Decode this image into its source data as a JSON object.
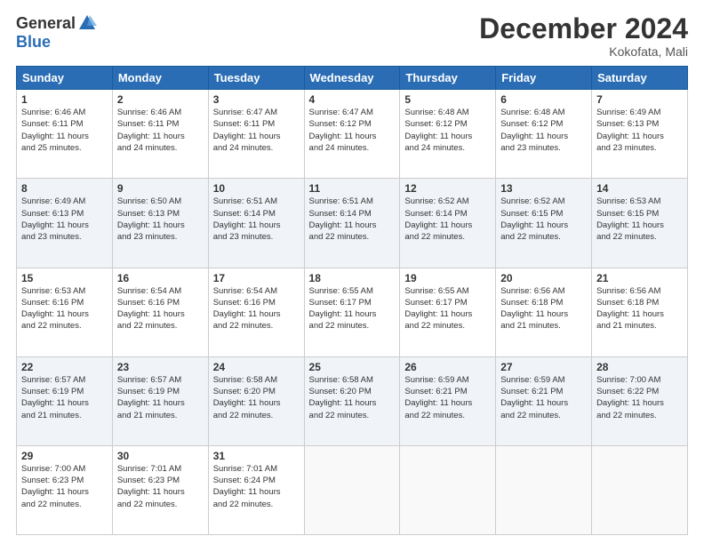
{
  "logo": {
    "general": "General",
    "blue": "Blue"
  },
  "title": "December 2024",
  "location": "Kokofata, Mali",
  "days_header": [
    "Sunday",
    "Monday",
    "Tuesday",
    "Wednesday",
    "Thursday",
    "Friday",
    "Saturday"
  ],
  "weeks": [
    [
      {
        "day": "1",
        "info": "Sunrise: 6:46 AM\nSunset: 6:11 PM\nDaylight: 11 hours\nand 25 minutes."
      },
      {
        "day": "2",
        "info": "Sunrise: 6:46 AM\nSunset: 6:11 PM\nDaylight: 11 hours\nand 24 minutes."
      },
      {
        "day": "3",
        "info": "Sunrise: 6:47 AM\nSunset: 6:11 PM\nDaylight: 11 hours\nand 24 minutes."
      },
      {
        "day": "4",
        "info": "Sunrise: 6:47 AM\nSunset: 6:12 PM\nDaylight: 11 hours\nand 24 minutes."
      },
      {
        "day": "5",
        "info": "Sunrise: 6:48 AM\nSunset: 6:12 PM\nDaylight: 11 hours\nand 24 minutes."
      },
      {
        "day": "6",
        "info": "Sunrise: 6:48 AM\nSunset: 6:12 PM\nDaylight: 11 hours\nand 23 minutes."
      },
      {
        "day": "7",
        "info": "Sunrise: 6:49 AM\nSunset: 6:13 PM\nDaylight: 11 hours\nand 23 minutes."
      }
    ],
    [
      {
        "day": "8",
        "info": "Sunrise: 6:49 AM\nSunset: 6:13 PM\nDaylight: 11 hours\nand 23 minutes."
      },
      {
        "day": "9",
        "info": "Sunrise: 6:50 AM\nSunset: 6:13 PM\nDaylight: 11 hours\nand 23 minutes."
      },
      {
        "day": "10",
        "info": "Sunrise: 6:51 AM\nSunset: 6:14 PM\nDaylight: 11 hours\nand 23 minutes."
      },
      {
        "day": "11",
        "info": "Sunrise: 6:51 AM\nSunset: 6:14 PM\nDaylight: 11 hours\nand 22 minutes."
      },
      {
        "day": "12",
        "info": "Sunrise: 6:52 AM\nSunset: 6:14 PM\nDaylight: 11 hours\nand 22 minutes."
      },
      {
        "day": "13",
        "info": "Sunrise: 6:52 AM\nSunset: 6:15 PM\nDaylight: 11 hours\nand 22 minutes."
      },
      {
        "day": "14",
        "info": "Sunrise: 6:53 AM\nSunset: 6:15 PM\nDaylight: 11 hours\nand 22 minutes."
      }
    ],
    [
      {
        "day": "15",
        "info": "Sunrise: 6:53 AM\nSunset: 6:16 PM\nDaylight: 11 hours\nand 22 minutes."
      },
      {
        "day": "16",
        "info": "Sunrise: 6:54 AM\nSunset: 6:16 PM\nDaylight: 11 hours\nand 22 minutes."
      },
      {
        "day": "17",
        "info": "Sunrise: 6:54 AM\nSunset: 6:16 PM\nDaylight: 11 hours\nand 22 minutes."
      },
      {
        "day": "18",
        "info": "Sunrise: 6:55 AM\nSunset: 6:17 PM\nDaylight: 11 hours\nand 22 minutes."
      },
      {
        "day": "19",
        "info": "Sunrise: 6:55 AM\nSunset: 6:17 PM\nDaylight: 11 hours\nand 22 minutes."
      },
      {
        "day": "20",
        "info": "Sunrise: 6:56 AM\nSunset: 6:18 PM\nDaylight: 11 hours\nand 21 minutes."
      },
      {
        "day": "21",
        "info": "Sunrise: 6:56 AM\nSunset: 6:18 PM\nDaylight: 11 hours\nand 21 minutes."
      }
    ],
    [
      {
        "day": "22",
        "info": "Sunrise: 6:57 AM\nSunset: 6:19 PM\nDaylight: 11 hours\nand 21 minutes."
      },
      {
        "day": "23",
        "info": "Sunrise: 6:57 AM\nSunset: 6:19 PM\nDaylight: 11 hours\nand 21 minutes."
      },
      {
        "day": "24",
        "info": "Sunrise: 6:58 AM\nSunset: 6:20 PM\nDaylight: 11 hours\nand 22 minutes."
      },
      {
        "day": "25",
        "info": "Sunrise: 6:58 AM\nSunset: 6:20 PM\nDaylight: 11 hours\nand 22 minutes."
      },
      {
        "day": "26",
        "info": "Sunrise: 6:59 AM\nSunset: 6:21 PM\nDaylight: 11 hours\nand 22 minutes."
      },
      {
        "day": "27",
        "info": "Sunrise: 6:59 AM\nSunset: 6:21 PM\nDaylight: 11 hours\nand 22 minutes."
      },
      {
        "day": "28",
        "info": "Sunrise: 7:00 AM\nSunset: 6:22 PM\nDaylight: 11 hours\nand 22 minutes."
      }
    ],
    [
      {
        "day": "29",
        "info": "Sunrise: 7:00 AM\nSunset: 6:23 PM\nDaylight: 11 hours\nand 22 minutes."
      },
      {
        "day": "30",
        "info": "Sunrise: 7:01 AM\nSunset: 6:23 PM\nDaylight: 11 hours\nand 22 minutes."
      },
      {
        "day": "31",
        "info": "Sunrise: 7:01 AM\nSunset: 6:24 PM\nDaylight: 11 hours\nand 22 minutes."
      },
      null,
      null,
      null,
      null
    ]
  ]
}
